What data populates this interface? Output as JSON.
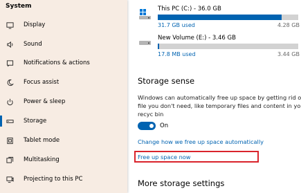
{
  "sidebar": {
    "title": "System",
    "items": [
      {
        "label": "Display",
        "icon": "display-icon"
      },
      {
        "label": "Sound",
        "icon": "speaker-icon"
      },
      {
        "label": "Notifications & actions",
        "icon": "notification-icon"
      },
      {
        "label": "Focus assist",
        "icon": "moon-icon"
      },
      {
        "label": "Power & sleep",
        "icon": "power-icon"
      },
      {
        "label": "Storage",
        "icon": "storage-icon",
        "active": true
      },
      {
        "label": "Tablet mode",
        "icon": "tablet-icon"
      },
      {
        "label": "Multitasking",
        "icon": "multitasking-icon"
      },
      {
        "label": "Projecting to this PC",
        "icon": "projector-icon"
      }
    ]
  },
  "drives": [
    {
      "name": "This PC (C:) - 36.0 GB",
      "used": "31.7 GB used",
      "total": "4.28 GB",
      "fill": 0.88,
      "icon": "windows-drive-icon"
    },
    {
      "name": "New Volume (E:) - 3.46 GB",
      "used": "17.8 MB used",
      "total": "3.44 GB",
      "fill": 0.005,
      "icon": "drive-icon"
    }
  ],
  "storage_sense": {
    "title": "Storage sense",
    "description": "Windows can automatically free up space by getting rid of file you don't need, like temporary files and content in your recyc bin",
    "toggle_label": "On",
    "toggle_on": true,
    "link_change": "Change how we free up space automatically",
    "link_free": "Free up space now"
  },
  "more": {
    "title": "More storage settings"
  },
  "colors": {
    "accent": "#0063b1",
    "highlight": "#d9232b",
    "sidebar_bg": "#f7ece3"
  }
}
